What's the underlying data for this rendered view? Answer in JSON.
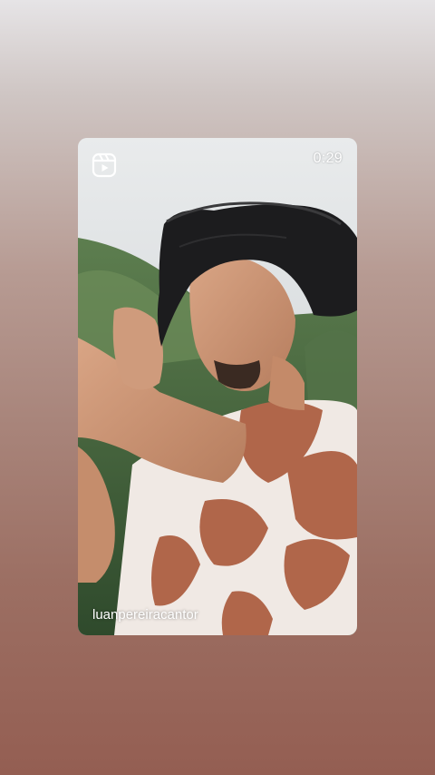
{
  "story": {
    "duration": "0:29",
    "username": "luanpereiracantor",
    "media_icon": "reels-icon",
    "media_description_icon": "person-in-hat-photo"
  },
  "colors": {
    "background_top": "#e6e4e6",
    "background_bottom": "#945e52",
    "shirt_pattern": "#b0664a"
  }
}
